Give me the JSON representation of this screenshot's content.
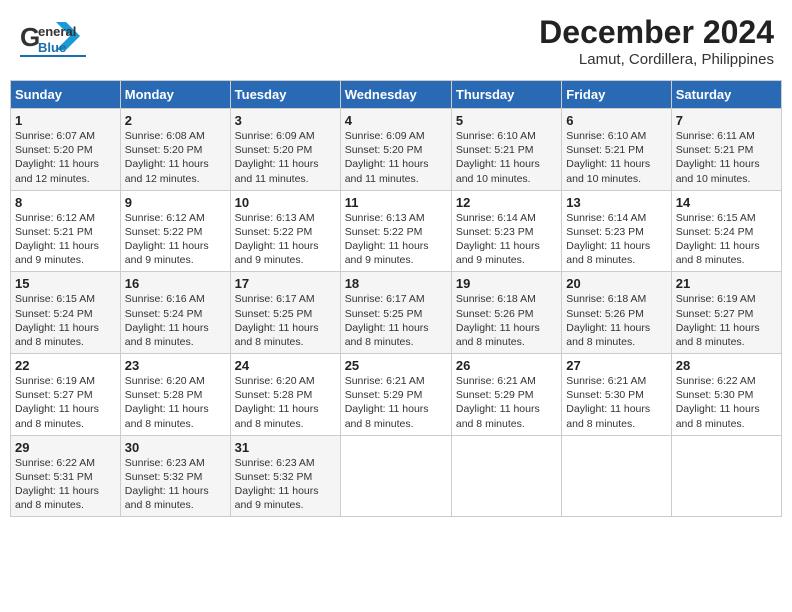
{
  "header": {
    "logo_line1": "General",
    "logo_line2": "Blue",
    "title": "December 2024",
    "subtitle": "Lamut, Cordillera, Philippines"
  },
  "calendar": {
    "month": "December 2024",
    "location": "Lamut, Cordillera, Philippines",
    "days_of_week": [
      "Sunday",
      "Monday",
      "Tuesday",
      "Wednesday",
      "Thursday",
      "Friday",
      "Saturday"
    ],
    "weeks": [
      [
        {
          "day": "1",
          "info": "Sunrise: 6:07 AM\nSunset: 5:20 PM\nDaylight: 11 hours\nand 12 minutes."
        },
        {
          "day": "2",
          "info": "Sunrise: 6:08 AM\nSunset: 5:20 PM\nDaylight: 11 hours\nand 12 minutes."
        },
        {
          "day": "3",
          "info": "Sunrise: 6:09 AM\nSunset: 5:20 PM\nDaylight: 11 hours\nand 11 minutes."
        },
        {
          "day": "4",
          "info": "Sunrise: 6:09 AM\nSunset: 5:20 PM\nDaylight: 11 hours\nand 11 minutes."
        },
        {
          "day": "5",
          "info": "Sunrise: 6:10 AM\nSunset: 5:21 PM\nDaylight: 11 hours\nand 10 minutes."
        },
        {
          "day": "6",
          "info": "Sunrise: 6:10 AM\nSunset: 5:21 PM\nDaylight: 11 hours\nand 10 minutes."
        },
        {
          "day": "7",
          "info": "Sunrise: 6:11 AM\nSunset: 5:21 PM\nDaylight: 11 hours\nand 10 minutes."
        }
      ],
      [
        {
          "day": "8",
          "info": "Sunrise: 6:12 AM\nSunset: 5:21 PM\nDaylight: 11 hours\nand 9 minutes."
        },
        {
          "day": "9",
          "info": "Sunrise: 6:12 AM\nSunset: 5:22 PM\nDaylight: 11 hours\nand 9 minutes."
        },
        {
          "day": "10",
          "info": "Sunrise: 6:13 AM\nSunset: 5:22 PM\nDaylight: 11 hours\nand 9 minutes."
        },
        {
          "day": "11",
          "info": "Sunrise: 6:13 AM\nSunset: 5:22 PM\nDaylight: 11 hours\nand 9 minutes."
        },
        {
          "day": "12",
          "info": "Sunrise: 6:14 AM\nSunset: 5:23 PM\nDaylight: 11 hours\nand 9 minutes."
        },
        {
          "day": "13",
          "info": "Sunrise: 6:14 AM\nSunset: 5:23 PM\nDaylight: 11 hours\nand 8 minutes."
        },
        {
          "day": "14",
          "info": "Sunrise: 6:15 AM\nSunset: 5:24 PM\nDaylight: 11 hours\nand 8 minutes."
        }
      ],
      [
        {
          "day": "15",
          "info": "Sunrise: 6:15 AM\nSunset: 5:24 PM\nDaylight: 11 hours\nand 8 minutes."
        },
        {
          "day": "16",
          "info": "Sunrise: 6:16 AM\nSunset: 5:24 PM\nDaylight: 11 hours\nand 8 minutes."
        },
        {
          "day": "17",
          "info": "Sunrise: 6:17 AM\nSunset: 5:25 PM\nDaylight: 11 hours\nand 8 minutes."
        },
        {
          "day": "18",
          "info": "Sunrise: 6:17 AM\nSunset: 5:25 PM\nDaylight: 11 hours\nand 8 minutes."
        },
        {
          "day": "19",
          "info": "Sunrise: 6:18 AM\nSunset: 5:26 PM\nDaylight: 11 hours\nand 8 minutes."
        },
        {
          "day": "20",
          "info": "Sunrise: 6:18 AM\nSunset: 5:26 PM\nDaylight: 11 hours\nand 8 minutes."
        },
        {
          "day": "21",
          "info": "Sunrise: 6:19 AM\nSunset: 5:27 PM\nDaylight: 11 hours\nand 8 minutes."
        }
      ],
      [
        {
          "day": "22",
          "info": "Sunrise: 6:19 AM\nSunset: 5:27 PM\nDaylight: 11 hours\nand 8 minutes."
        },
        {
          "day": "23",
          "info": "Sunrise: 6:20 AM\nSunset: 5:28 PM\nDaylight: 11 hours\nand 8 minutes."
        },
        {
          "day": "24",
          "info": "Sunrise: 6:20 AM\nSunset: 5:28 PM\nDaylight: 11 hours\nand 8 minutes."
        },
        {
          "day": "25",
          "info": "Sunrise: 6:21 AM\nSunset: 5:29 PM\nDaylight: 11 hours\nand 8 minutes."
        },
        {
          "day": "26",
          "info": "Sunrise: 6:21 AM\nSunset: 5:29 PM\nDaylight: 11 hours\nand 8 minutes."
        },
        {
          "day": "27",
          "info": "Sunrise: 6:21 AM\nSunset: 5:30 PM\nDaylight: 11 hours\nand 8 minutes."
        },
        {
          "day": "28",
          "info": "Sunrise: 6:22 AM\nSunset: 5:30 PM\nDaylight: 11 hours\nand 8 minutes."
        }
      ],
      [
        {
          "day": "29",
          "info": "Sunrise: 6:22 AM\nSunset: 5:31 PM\nDaylight: 11 hours\nand 8 minutes."
        },
        {
          "day": "30",
          "info": "Sunrise: 6:23 AM\nSunset: 5:32 PM\nDaylight: 11 hours\nand 8 minutes."
        },
        {
          "day": "31",
          "info": "Sunrise: 6:23 AM\nSunset: 5:32 PM\nDaylight: 11 hours\nand 9 minutes."
        },
        {
          "day": "",
          "info": ""
        },
        {
          "day": "",
          "info": ""
        },
        {
          "day": "",
          "info": ""
        },
        {
          "day": "",
          "info": ""
        }
      ]
    ]
  }
}
